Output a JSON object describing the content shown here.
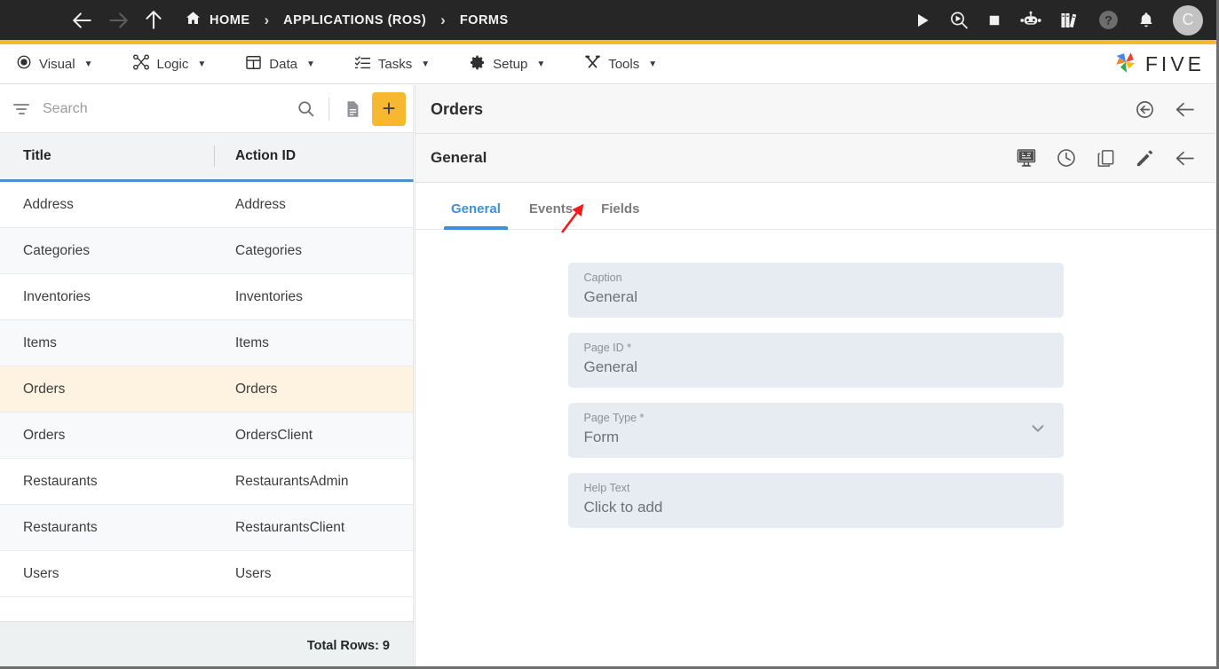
{
  "topbar": {
    "nav": {
      "menu_icon": "hamburger-icon",
      "back_icon": "arrow-left-icon",
      "forward_icon": "arrow-right-icon",
      "up_icon": "arrow-up-icon"
    },
    "breadcrumbs": [
      {
        "label": "HOME",
        "icon": "home-icon"
      },
      {
        "label": "APPLICATIONS (ROS)",
        "icon": ""
      },
      {
        "label": "FORMS",
        "icon": ""
      }
    ],
    "separator": "›",
    "actions": [
      {
        "name": "run-icon",
        "title": "Run"
      },
      {
        "name": "debug-icon",
        "title": "Debug"
      },
      {
        "name": "stop-icon",
        "title": "Stop"
      },
      {
        "name": "robot-icon",
        "title": "Assistant"
      },
      {
        "name": "library-icon",
        "title": "Docs"
      },
      {
        "name": "help-icon",
        "title": "Help"
      },
      {
        "name": "bell-icon",
        "title": "Notifications"
      }
    ],
    "avatar_initial": "C"
  },
  "menubar": {
    "items": [
      {
        "label": "Visual",
        "icon": "eye-icon"
      },
      {
        "label": "Logic",
        "icon": "logic-nodes-icon"
      },
      {
        "label": "Data",
        "icon": "table-grid-icon"
      },
      {
        "label": "Tasks",
        "icon": "checklist-icon"
      },
      {
        "label": "Setup",
        "icon": "gear-icon"
      },
      {
        "label": "Tools",
        "icon": "tools-icon"
      }
    ],
    "caret": "▼",
    "brand": "FIVE"
  },
  "sidebar": {
    "search": {
      "value": "",
      "placeholder": "Search"
    },
    "toolbar": {
      "filter_icon": "filter-icon",
      "search_icon": "search-icon",
      "document_icon": "document-icon",
      "add_label": "+"
    },
    "columns": [
      "Title",
      "Action ID"
    ],
    "rows": [
      {
        "title": "Address",
        "action_id": "Address"
      },
      {
        "title": "Categories",
        "action_id": "Categories"
      },
      {
        "title": "Inventories",
        "action_id": "Inventories"
      },
      {
        "title": "Items",
        "action_id": "Items"
      },
      {
        "title": "Orders",
        "action_id": "Orders"
      },
      {
        "title": "Orders",
        "action_id": "OrdersClient"
      },
      {
        "title": "Restaurants",
        "action_id": "RestaurantsAdmin"
      },
      {
        "title": "Restaurants",
        "action_id": "RestaurantsClient"
      },
      {
        "title": "Users",
        "action_id": "Users"
      }
    ],
    "selected_row_index": 4,
    "footer": "Total Rows: 9"
  },
  "detail": {
    "header": {
      "title": "Orders",
      "actions": [
        {
          "name": "revert-icon",
          "title": "Revert"
        },
        {
          "name": "back-arrow-icon",
          "title": "Back"
        }
      ]
    },
    "subheader": {
      "title": "General",
      "actions": [
        {
          "name": "display-preview-icon",
          "title": "Preview"
        },
        {
          "name": "history-clock-icon",
          "title": "History"
        },
        {
          "name": "duplicate-icon",
          "title": "Duplicate"
        },
        {
          "name": "edit-pencil-icon",
          "title": "Edit"
        },
        {
          "name": "back-arrow-icon",
          "title": "Back"
        }
      ]
    },
    "tabs": [
      {
        "label": "General",
        "active": true
      },
      {
        "label": "Events",
        "active": false
      },
      {
        "label": "Fields",
        "active": false
      }
    ],
    "fields": [
      {
        "label": "Caption",
        "value": "General",
        "type": "text"
      },
      {
        "label": "Page ID *",
        "value": "General",
        "type": "text"
      },
      {
        "label": "Page Type *",
        "value": "Form",
        "type": "select"
      },
      {
        "label": "Help Text",
        "value": "Click to add",
        "type": "text"
      }
    ]
  },
  "annotation": {
    "arrow_color": "#ef1c1c",
    "points_to": "Fields"
  },
  "colors": {
    "accent_yellow": "#F5B82E",
    "topbar_dark": "#262626",
    "tab_blue": "#3F8FD9",
    "selected_row": "#FDF3E0",
    "field_bg": "#E6ECF2"
  }
}
